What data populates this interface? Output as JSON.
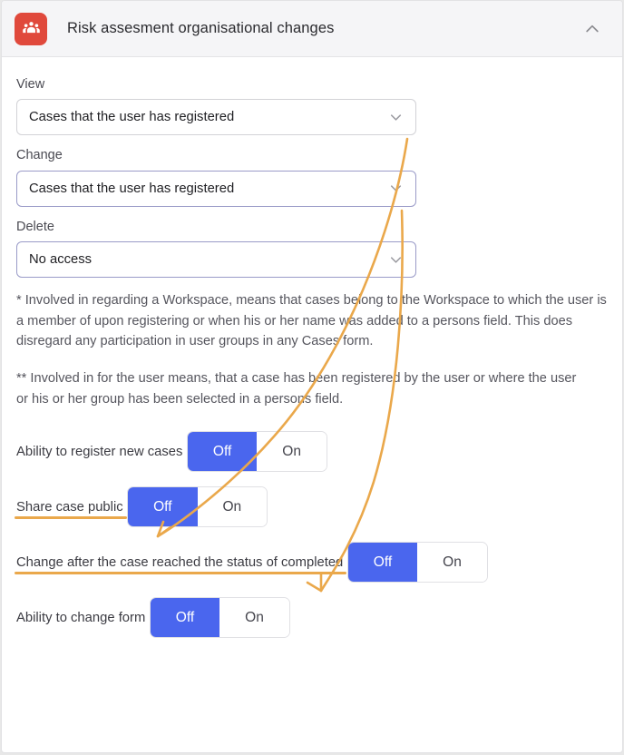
{
  "header": {
    "icon": "users-group-icon",
    "icon_color": "#e0493c",
    "title": "Risk assesment organisational changes",
    "collapse_icon": "chevron-up-icon"
  },
  "fields": [
    {
      "label": "View",
      "value": "Cases that the user has registered",
      "state": "plain",
      "icon": "chevron-down-icon"
    },
    {
      "label": "Change",
      "value": "Cases that the user has registered",
      "state": "focus",
      "icon": "chevron-down-icon"
    },
    {
      "label": "Delete",
      "value": "No access",
      "state": "focus",
      "icon": "chevron-down-icon"
    }
  ],
  "notes": {
    "first": "* Involved in regarding a Workspace, means that cases belong to the Workspace to which the user is a member of upon registering or when his or her name was added to a persons field. This does disregard any participation in user groups in any Cases form.",
    "second": "** Involved in for the user means, that a case has been registered by the user or where the user or his or her group has been selected in a persons field."
  },
  "toggles": [
    {
      "label": "Ability to register new cases",
      "off_label": "Off",
      "on_label": "On",
      "selected": "Off",
      "highlighted": false
    },
    {
      "label": "Share case public",
      "off_label": "Off",
      "on_label": "On",
      "selected": "Off",
      "highlighted": true
    },
    {
      "label": "Change after the case reached the status of completed",
      "off_label": "Off",
      "on_label": "On",
      "selected": "Off",
      "highlighted": true
    },
    {
      "label": "Ability to change form",
      "off_label": "Off",
      "on_label": "On",
      "selected": "Off",
      "highlighted": false
    }
  ],
  "annotations": {
    "color": "#eaa84b",
    "arrows": [
      {
        "name": "arrow-view-to-share-case-public"
      },
      {
        "name": "arrow-change-to-status-completed"
      }
    ]
  },
  "colors": {
    "accent_blue": "#4a66ee",
    "brand_red": "#e0493c",
    "annotation_orange": "#eaa84b",
    "focus_border": "#9a9bc8"
  }
}
